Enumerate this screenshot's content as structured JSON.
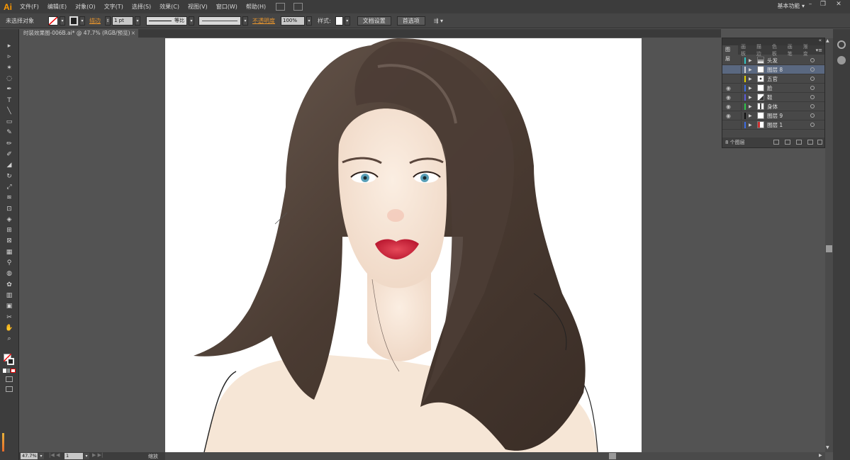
{
  "app": {
    "logo": "Ai",
    "workspace": "基本功能"
  },
  "menu": [
    "文件(F)",
    "编辑(E)",
    "对象(O)",
    "文字(T)",
    "选择(S)",
    "效果(C)",
    "视图(V)",
    "窗口(W)",
    "帮助(H)"
  ],
  "control": {
    "selection": "未选择对象",
    "stroke_label": "描边",
    "stroke_weight": "1 pt",
    "stroke_profile": "等比",
    "opacity_label": "不透明度",
    "opacity_value": "100%",
    "style_label": "样式:",
    "doc_setup": "文档设置",
    "preferences": "首选项"
  },
  "document": {
    "tab_title": "时装效果图-006B.ai* @ 47.7% (RGB/预览)"
  },
  "layers": {
    "tabs": [
      "图层",
      "画板",
      "描边",
      "色板",
      "画笔",
      "渐变"
    ],
    "rows": [
      {
        "name": "头发",
        "visible": false,
        "color": "#31c4c4",
        "selected": false,
        "thumb": "hair"
      },
      {
        "name": "图层 8",
        "visible": false,
        "color": "#d0d0d0",
        "selected": true,
        "thumb": "blank"
      },
      {
        "name": "五官",
        "visible": false,
        "color": "#e0d000",
        "selected": false,
        "thumb": "face"
      },
      {
        "name": "脸",
        "visible": true,
        "color": "#3d6be0",
        "selected": false,
        "thumb": "blank"
      },
      {
        "name": "鞋",
        "visible": true,
        "color": "#5a5ad8",
        "selected": false,
        "thumb": "shoe"
      },
      {
        "name": "身体",
        "visible": true,
        "color": "#2ec44a",
        "selected": false,
        "thumb": "body"
      },
      {
        "name": "图层 9",
        "visible": true,
        "color": "#111111",
        "selected": false,
        "thumb": "blank"
      },
      {
        "name": "图层 1",
        "visible": false,
        "color": "#3d6be0",
        "selected": false,
        "thumb": "red"
      }
    ],
    "count": "8 个图层"
  },
  "status": {
    "zoom": "47.7%",
    "artboard": "1",
    "tool": "缩放"
  },
  "icons": {
    "tools": [
      "selection-icon",
      "direct-selection-icon",
      "magic-wand-icon",
      "lasso-icon",
      "pen-icon",
      "type-icon",
      "line-icon",
      "rectangle-icon",
      "paintbrush-icon",
      "pencil-icon",
      "blob-brush-icon",
      "eraser-icon",
      "rotate-icon",
      "scale-icon",
      "warp-icon",
      "free-transform-icon",
      "shape-builder-icon",
      "perspective-icon",
      "mesh-icon",
      "gradient-icon",
      "eyedropper-icon",
      "blend-icon",
      "symbol-sprayer-icon",
      "column-graph-icon",
      "artboard-icon",
      "slice-icon",
      "hand-icon",
      "zoom-icon"
    ]
  },
  "colors": {
    "menubar": "#3c3c3c",
    "panel": "#484848",
    "selected_layer": "#5a6880",
    "accent_orange": "#e8952d"
  }
}
